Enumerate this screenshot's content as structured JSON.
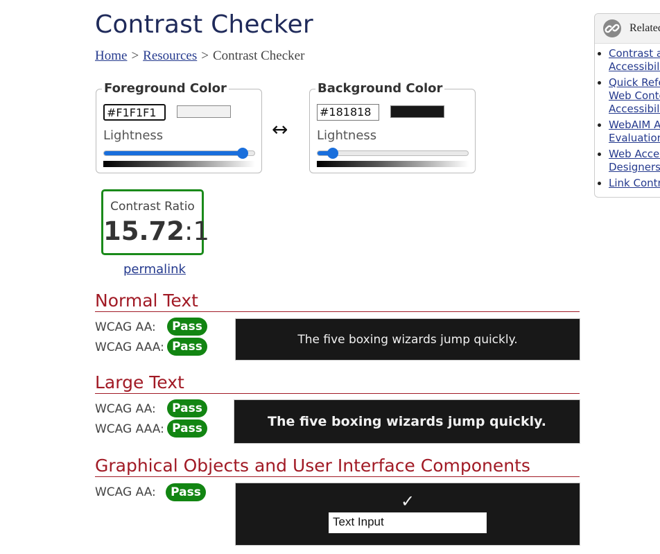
{
  "page": {
    "title": "Contrast Checker",
    "breadcrumb": {
      "home": "Home",
      "sep1": ">",
      "resources": "Resources",
      "sep2": ">",
      "current": "Contrast Checker"
    }
  },
  "foreground": {
    "legend": "Foreground Color",
    "hex": "#F1F1F1",
    "swatch_color": "#f1f1f1",
    "lightness_label": "Lightness",
    "lightness_level": 0.92
  },
  "background": {
    "legend": "Background Color",
    "hex": "#181818",
    "swatch_color": "#181818",
    "lightness_label": "Lightness",
    "lightness_level": 0.1
  },
  "swap_symbol": "↔",
  "ratio": {
    "label": "Contrast Ratio",
    "value_bold": "15.72",
    "value_rest": ":1"
  },
  "permalink": "permalink",
  "normal_text": {
    "heading": "Normal Text",
    "aa_label": "WCAG AA:",
    "aa_result": "Pass",
    "aaa_label": "WCAG AAA:",
    "aaa_result": "Pass",
    "sample": "The five boxing wizards jump quickly."
  },
  "large_text": {
    "heading": "Large Text",
    "aa_label": "WCAG AA:",
    "aa_result": "Pass",
    "aaa_label": "WCAG AAA:",
    "aaa_result": "Pass",
    "sample": "The five boxing wizards jump quickly."
  },
  "graphical": {
    "heading": "Graphical Objects and User Interface Components",
    "aa_label": "WCAG AA:",
    "aa_result": "Pass",
    "check_glyph": "✓",
    "input_value": "Text Input"
  },
  "related": {
    "title": "Related",
    "items": [
      {
        "line1": "Contrast a",
        "line2": "Accessibilit"
      },
      {
        "line1": "Quick Refe",
        "line2": "Web Conte",
        "line3": "Accessibilit"
      },
      {
        "line1": "WebAIM A",
        "line2": "Evaluation"
      },
      {
        "line1": "Web Acces",
        "line2": "Designers"
      },
      {
        "line1": "Link Contra"
      }
    ]
  },
  "colors": {
    "pass_green": "#128512",
    "section_red": "#a11a25",
    "link_blue": "#253a8e",
    "slider_blue": "#1a6fdc",
    "preview_bg": "#181818",
    "preview_fg": "#f1f1f1"
  }
}
